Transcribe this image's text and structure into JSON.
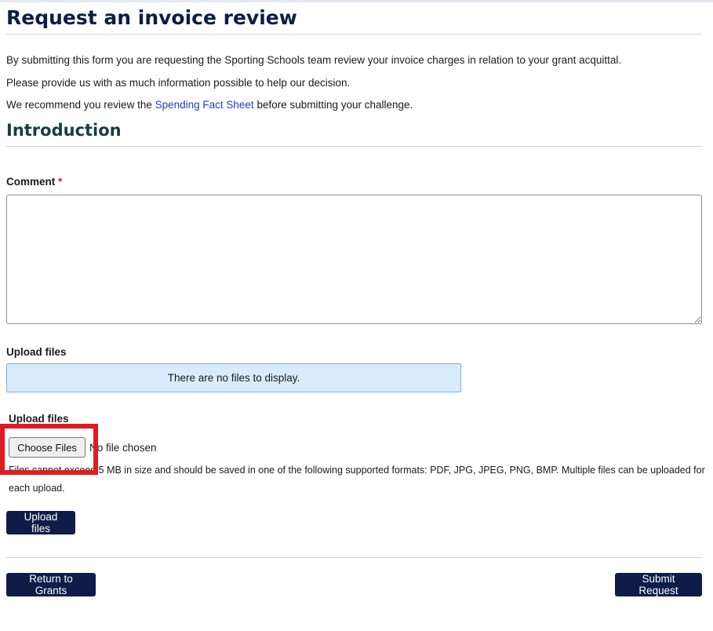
{
  "page": {
    "title": "Request an invoice review",
    "intro": {
      "line1": "By submitting this form you are requesting the Sporting Schools team review your invoice charges in relation to your grant acquittal.",
      "line2": "Please provide us with as much information possible to help our decision.",
      "line3_before": "We recommend you review the ",
      "line3_link": "Spending Fact Sheet",
      "line3_after": " before submitting your challenge."
    },
    "section_title": "Introduction"
  },
  "form": {
    "comment_label": "Comment",
    "required_marker": "*",
    "comment_value": "",
    "upload_list_label": "Upload files",
    "no_files_message": "There are no files to display.",
    "upload_input_label": "Upload files",
    "choose_files_label": "Choose Files",
    "no_file_chosen": "No file chosen",
    "file_help": "Files cannot exceed 5 MB in size and should be saved in one of the following supported formats: PDF, JPG, JPEG, PNG, BMP. Multiple files can be uploaded for each upload.",
    "upload_button_label": "Upload files"
  },
  "footer": {
    "return_label": "Return to Grants",
    "submit_label": "Submit Request"
  },
  "colors": {
    "primary_navy": "#0e1c47",
    "section_heading": "#15403f",
    "link": "#1c3fc0",
    "info_box": "#d9ecfb",
    "highlight": "#e11b22",
    "required": "#c0272d"
  }
}
